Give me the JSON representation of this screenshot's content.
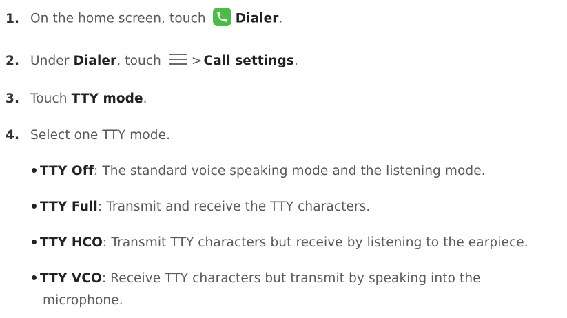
{
  "steps": [
    {
      "num": "1.",
      "pre": "On the home screen, touch",
      "bold": "Dialer",
      "post": "."
    },
    {
      "num": "2.",
      "pre": "Under ",
      "bold1": "Dialer",
      "mid": ", touch",
      "sep": ">",
      "bold2": "Call settings",
      "post": "."
    },
    {
      "num": "3.",
      "pre": "Touch ",
      "bold": "TTY mode",
      "post": "."
    },
    {
      "num": "4.",
      "text": "Select one TTY mode."
    }
  ],
  "modes": [
    {
      "name": "TTY Off",
      "desc": ": The standard voice speaking mode and the listening mode."
    },
    {
      "name": "TTY Full",
      "desc": ": Transmit and receive the TTY characters."
    },
    {
      "name": "TTY HCO",
      "desc": ": Transmit TTY characters but receive by listening to the earpiece."
    },
    {
      "name": "TTY VCO",
      "desc": ": Receive TTY characters but transmit by speaking into the",
      "desc_cont": "microphone."
    }
  ],
  "icons": {
    "dialer": "phone-icon",
    "menu": "menu-icon",
    "dialer_color": "#4cbb4a"
  }
}
